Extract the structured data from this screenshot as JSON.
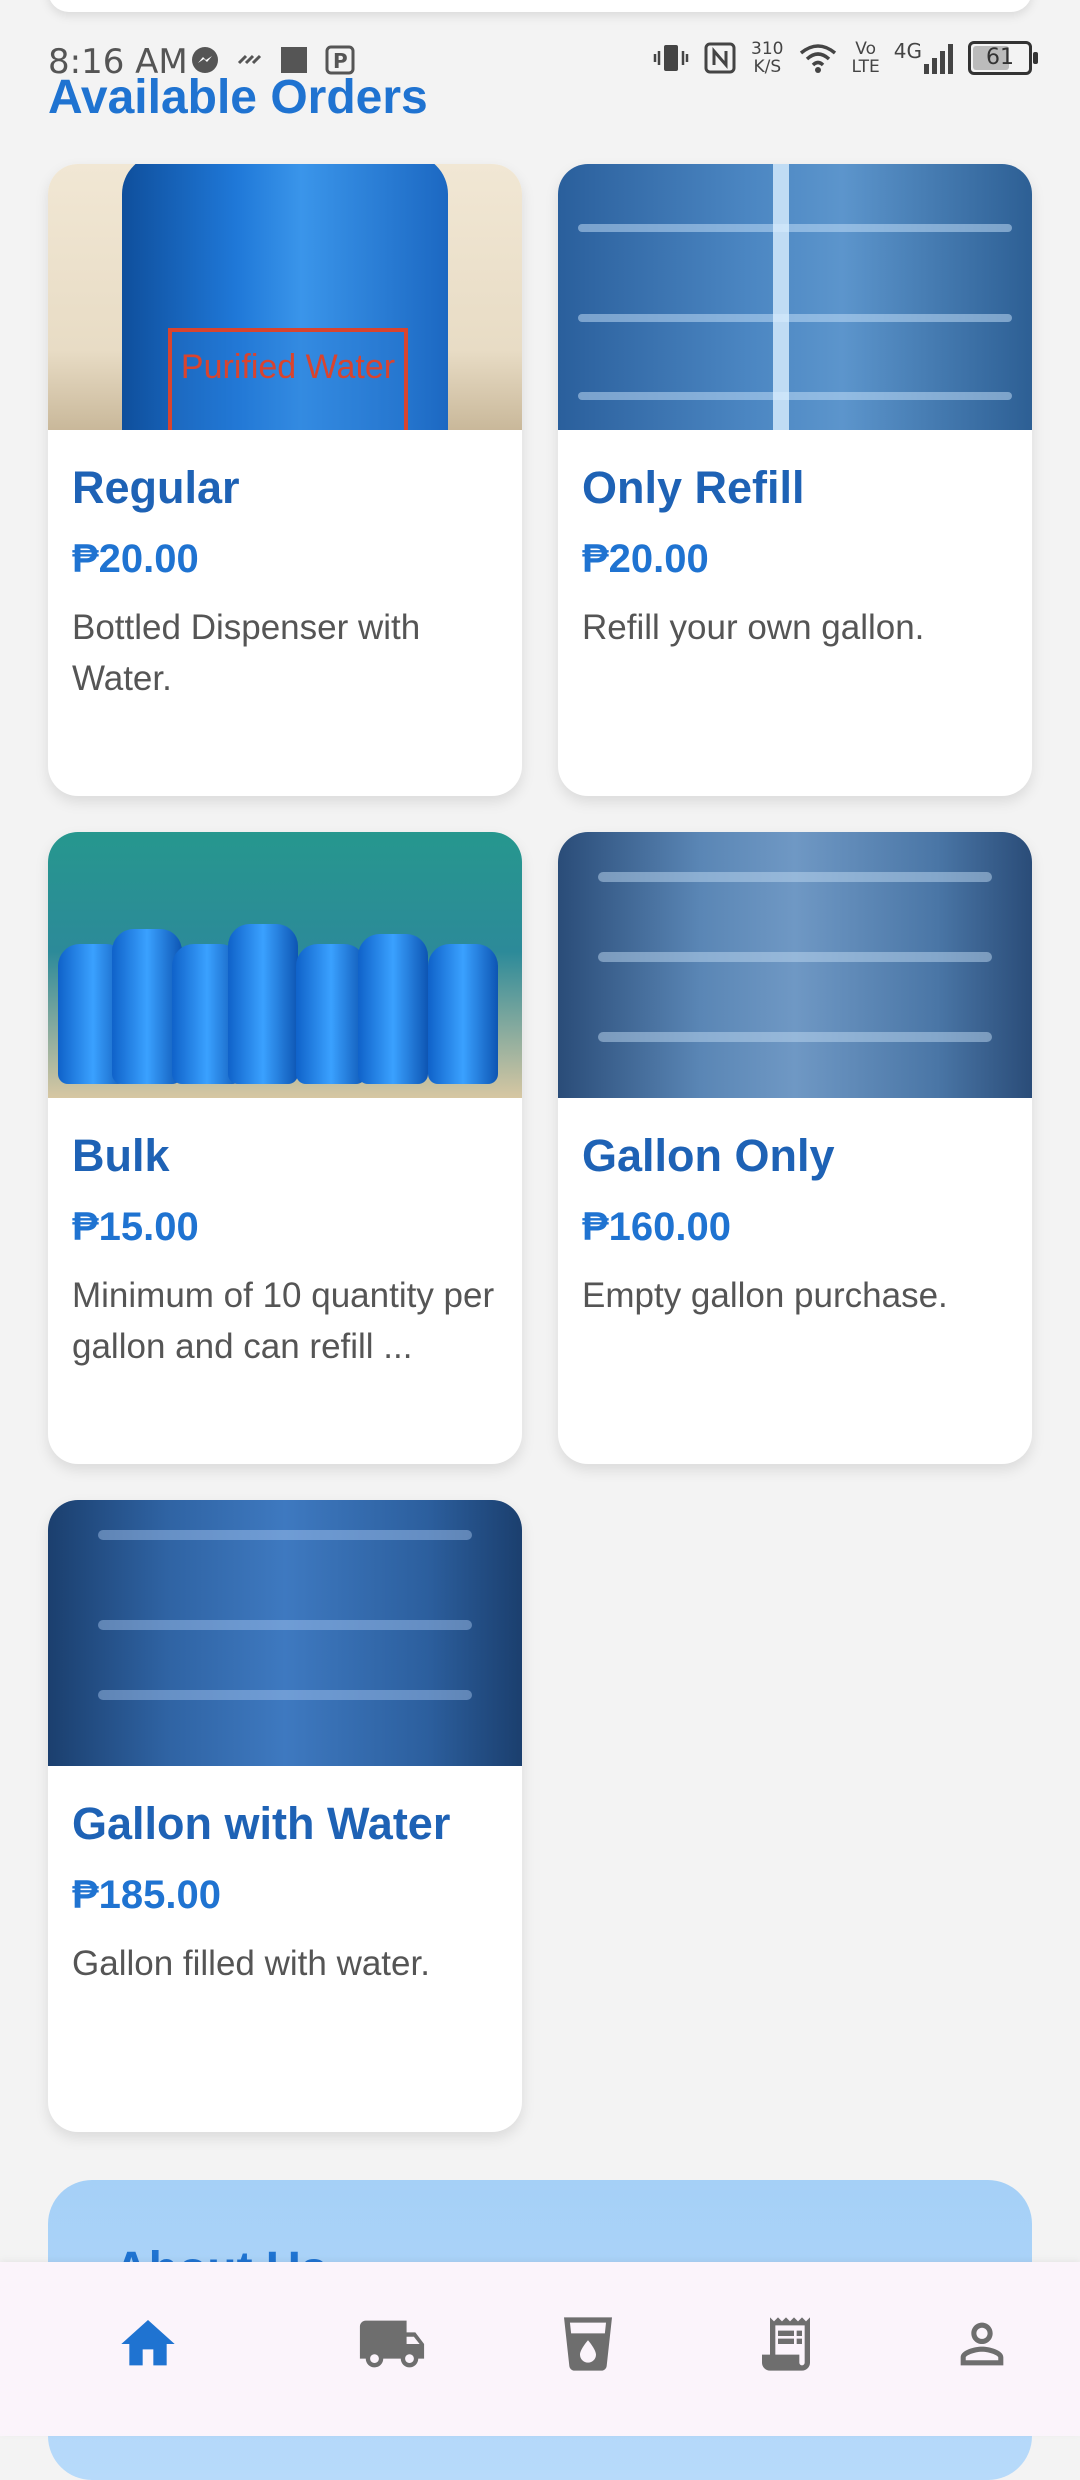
{
  "status_bar": {
    "time": "8:16 AM",
    "network_speed_value": "310",
    "network_speed_unit": "K/S",
    "volte_top": "Vo",
    "volte_bottom": "LTE",
    "network_type": "4G",
    "battery_level": "61"
  },
  "section_title": "Available Orders",
  "orders": [
    {
      "title": "Regular",
      "price": "₱20.00",
      "description": "Bottled Dispenser with Water.",
      "image_label": "Purified Water"
    },
    {
      "title": "Only Refill",
      "price": "₱20.00",
      "description": "Refill your own gallon."
    },
    {
      "title": "Bulk",
      "price": "₱15.00",
      "description": "Minimum of 10 quantity per gallon and can refill ..."
    },
    {
      "title": "Gallon Only",
      "price": "₱160.00",
      "description": "Empty gallon purchase."
    },
    {
      "title": "Gallon with Water",
      "price": "₱185.00",
      "description": "Gallon filled with water."
    }
  ],
  "about_section": {
    "title": "About Us"
  },
  "bottom_nav": {
    "items": [
      {
        "icon": "home-icon",
        "active": true
      },
      {
        "icon": "truck-icon",
        "active": false
      },
      {
        "icon": "water-cup-icon",
        "active": false
      },
      {
        "icon": "receipt-icon",
        "active": false
      },
      {
        "icon": "profile-icon",
        "active": false
      }
    ]
  },
  "colors": {
    "primary": "#1f73d1",
    "title_blue": "#1e62b5",
    "inactive_icon": "#6e6e6e",
    "background": "#f3f3f3",
    "about_bg": "#a5d0f7"
  }
}
